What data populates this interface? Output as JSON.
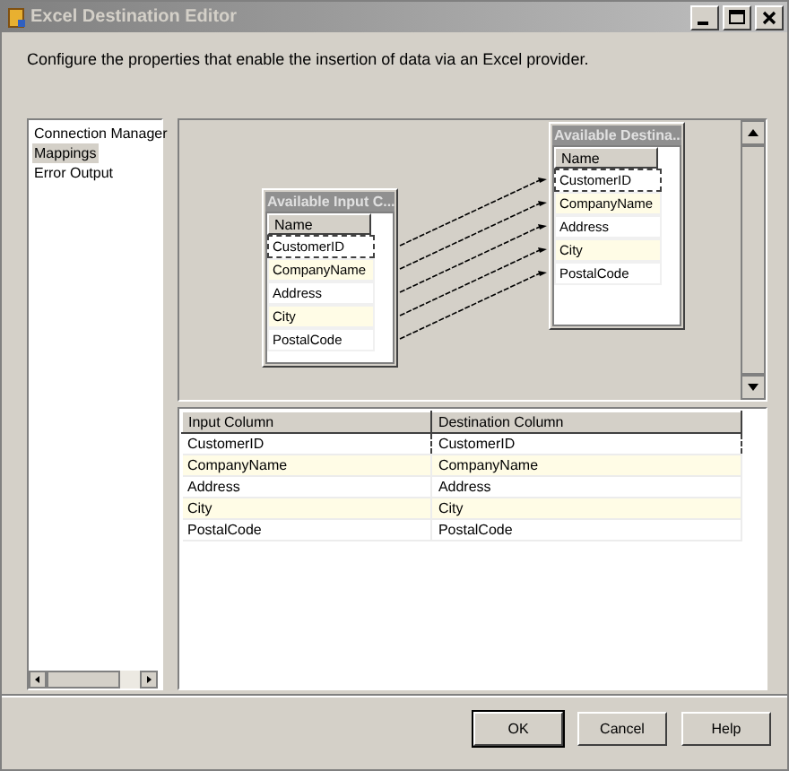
{
  "window": {
    "title": "Excel Destination Editor"
  },
  "description": "Configure the properties that enable the insertion of data via an Excel provider.",
  "sidebar": {
    "items": [
      {
        "label": "Connection Manager",
        "selected": false
      },
      {
        "label": "Mappings",
        "selected": true
      },
      {
        "label": "Error Output",
        "selected": false
      }
    ]
  },
  "canvas": {
    "input_table": {
      "title": "Available Input C...",
      "header": "Name",
      "columns": [
        {
          "name": "CustomerID",
          "focused": true,
          "mapped": true
        },
        {
          "name": "CompanyName",
          "focused": false,
          "mapped": true
        },
        {
          "name": "Address",
          "focused": false,
          "mapped": true
        },
        {
          "name": "City",
          "focused": false,
          "mapped": true
        },
        {
          "name": "PostalCode",
          "focused": false,
          "mapped": true
        }
      ]
    },
    "destination_table": {
      "title": "Available Destina...",
      "header": "Name",
      "columns": [
        {
          "name": "CustomerID",
          "focused": true
        },
        {
          "name": "CompanyName",
          "focused": false
        },
        {
          "name": "Address",
          "focused": false
        },
        {
          "name": "City",
          "focused": false
        },
        {
          "name": "PostalCode",
          "focused": false
        }
      ]
    }
  },
  "grid": {
    "columns": [
      "Input Column",
      "Destination Column"
    ],
    "rows": [
      {
        "cells": [
          "CustomerID",
          "CustomerID"
        ],
        "focused": true
      },
      {
        "cells": [
          "CompanyName",
          "CompanyName"
        ],
        "focused": false
      },
      {
        "cells": [
          "Address",
          "Address"
        ],
        "focused": false
      },
      {
        "cells": [
          "City",
          "City"
        ],
        "focused": false
      },
      {
        "cells": [
          "PostalCode",
          "PostalCode"
        ],
        "focused": false
      }
    ]
  },
  "buttons": [
    "OK",
    "Cancel",
    "Help"
  ]
}
